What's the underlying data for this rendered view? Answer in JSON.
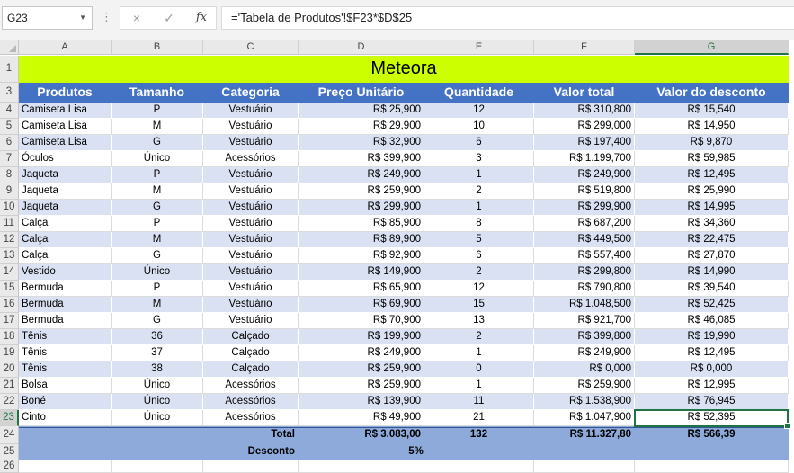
{
  "formula_bar": {
    "name_box": "G23",
    "cancel_icon": "×",
    "enter_icon": "✓",
    "fx_label": "fx",
    "formula": "='Tabela de Produtos'!$F23*$D$25"
  },
  "columns": [
    "A",
    "B",
    "C",
    "D",
    "E",
    "F",
    "G"
  ],
  "selected_column": "G",
  "selected_row": "23",
  "title": {
    "row": "1",
    "text": "Meteora"
  },
  "header": {
    "row": "3",
    "cells": [
      "Produtos",
      "Tamanho",
      "Categoria",
      "Preço Unitário",
      "Quantidade",
      "Valor total",
      "Valor do desconto"
    ]
  },
  "rows": [
    {
      "n": "4",
      "cells": [
        "Camiseta Lisa",
        "P",
        "Vestuário",
        "R$ 25,900",
        "12",
        "R$ 310,800",
        "R$ 15,540"
      ]
    },
    {
      "n": "5",
      "cells": [
        "Camiseta Lisa",
        "M",
        "Vestuário",
        "R$ 29,900",
        "10",
        "R$ 299,000",
        "R$ 14,950"
      ]
    },
    {
      "n": "6",
      "cells": [
        "Camiseta Lisa",
        "G",
        "Vestuário",
        "R$ 32,900",
        "6",
        "R$ 197,400",
        "R$ 9,870"
      ]
    },
    {
      "n": "7",
      "cells": [
        "Óculos",
        "Único",
        "Acessórios",
        "R$ 399,900",
        "3",
        "R$ 1.199,700",
        "R$ 59,985"
      ]
    },
    {
      "n": "8",
      "cells": [
        "Jaqueta",
        "P",
        "Vestuário",
        "R$ 249,900",
        "1",
        "R$ 249,900",
        "R$ 12,495"
      ]
    },
    {
      "n": "9",
      "cells": [
        "Jaqueta",
        "M",
        "Vestuário",
        "R$ 259,900",
        "2",
        "R$ 519,800",
        "R$ 25,990"
      ]
    },
    {
      "n": "10",
      "cells": [
        "Jaqueta",
        "G",
        "Vestuário",
        "R$ 299,900",
        "1",
        "R$ 299,900",
        "R$ 14,995"
      ]
    },
    {
      "n": "11",
      "cells": [
        "Calça",
        "P",
        "Vestuário",
        "R$ 85,900",
        "8",
        "R$ 687,200",
        "R$ 34,360"
      ]
    },
    {
      "n": "12",
      "cells": [
        "Calça",
        "M",
        "Vestuário",
        "R$ 89,900",
        "5",
        "R$ 449,500",
        "R$ 22,475"
      ]
    },
    {
      "n": "13",
      "cells": [
        "Calça",
        "G",
        "Vestuário",
        "R$ 92,900",
        "6",
        "R$ 557,400",
        "R$ 27,870"
      ]
    },
    {
      "n": "14",
      "cells": [
        "Vestido",
        "Único",
        "Vestuário",
        "R$ 149,900",
        "2",
        "R$ 299,800",
        "R$ 14,990"
      ]
    },
    {
      "n": "15",
      "cells": [
        "Bermuda",
        "P",
        "Vestuário",
        "R$ 65,900",
        "12",
        "R$ 790,800",
        "R$ 39,540"
      ]
    },
    {
      "n": "16",
      "cells": [
        "Bermuda",
        "M",
        "Vestuário",
        "R$ 69,900",
        "15",
        "R$ 1.048,500",
        "R$ 52,425"
      ]
    },
    {
      "n": "17",
      "cells": [
        "Bermuda",
        "G",
        "Vestuário",
        "R$ 70,900",
        "13",
        "R$ 921,700",
        "R$ 46,085"
      ]
    },
    {
      "n": "18",
      "cells": [
        "Tênis",
        "36",
        "Calçado",
        "R$ 199,900",
        "2",
        "R$ 399,800",
        "R$ 19,990"
      ]
    },
    {
      "n": "19",
      "cells": [
        "Tênis",
        "37",
        "Calçado",
        "R$ 249,900",
        "1",
        "R$ 249,900",
        "R$ 12,495"
      ]
    },
    {
      "n": "20",
      "cells": [
        "Tênis",
        "38",
        "Calçado",
        "R$ 259,900",
        "0",
        "R$ 0,000",
        "R$ 0,000"
      ]
    },
    {
      "n": "21",
      "cells": [
        "Bolsa",
        "Único",
        "Acessórios",
        "R$ 259,900",
        "1",
        "R$ 259,900",
        "R$ 12,995"
      ]
    },
    {
      "n": "22",
      "cells": [
        "Boné",
        "Único",
        "Acessórios",
        "R$ 139,900",
        "11",
        "R$ 1.538,900",
        "R$ 76,945"
      ]
    },
    {
      "n": "23",
      "cells": [
        "Cinto",
        "Único",
        "Acessórios",
        "R$ 49,900",
        "21",
        "R$ 1.047,900",
        "R$ 52,395"
      ]
    }
  ],
  "total": {
    "row": "24",
    "label": "Total",
    "preco": "R$ 3.083,00",
    "quantidade": "132",
    "valor_total": "R$ 11.327,80",
    "desconto": "R$ 566,39"
  },
  "desconto": {
    "row": "25",
    "label": "Desconto",
    "value": "5%"
  },
  "next_row": "26",
  "colors": {
    "title_bg": "#ccff00",
    "header_bg": "#4472c4",
    "band": "#d9e1f2",
    "total_bg": "#8eaadb",
    "selection": "#217346"
  }
}
